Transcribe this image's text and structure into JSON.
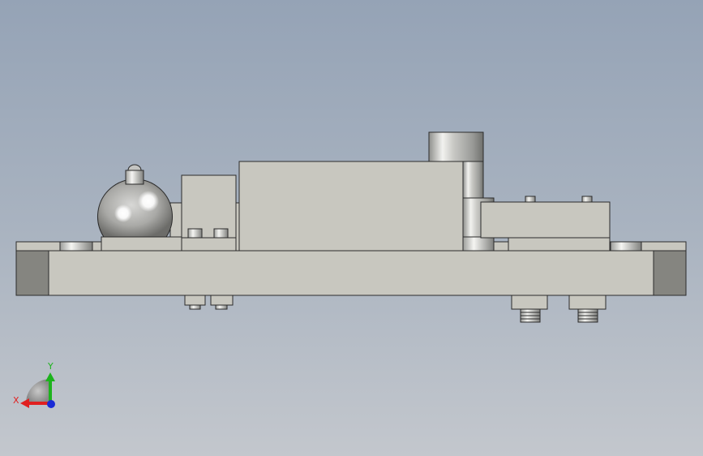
{
  "viewport": {
    "background_top": "#95a3b6",
    "background_bottom": "#c3c7cd"
  },
  "model": {
    "view": "front",
    "body_color": "#c8c7bf",
    "edge_color": "#2b2b2b",
    "dark_face_color": "#858580",
    "metal_color": "#b9bab8"
  },
  "triad": {
    "x_label": "X",
    "y_label": "Y",
    "x_color": "#e02020",
    "y_color": "#1db31d",
    "z_color": "#1a2bd6"
  }
}
